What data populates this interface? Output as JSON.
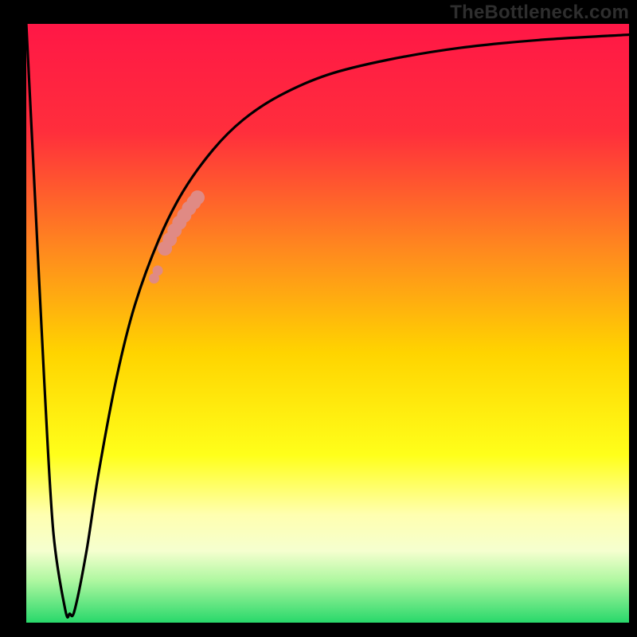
{
  "watermark": "TheBottleneck.com",
  "chart_data": {
    "type": "line",
    "title": "",
    "xlabel": "",
    "ylabel": "",
    "xlim": [
      0,
      100
    ],
    "ylim": [
      0,
      100
    ],
    "grid": false,
    "background_gradient": {
      "stops": [
        {
          "offset": 0.0,
          "color": "#ff1746"
        },
        {
          "offset": 0.18,
          "color": "#ff2e3c"
        },
        {
          "offset": 0.38,
          "color": "#ff8a1e"
        },
        {
          "offset": 0.55,
          "color": "#ffd400"
        },
        {
          "offset": 0.72,
          "color": "#ffff1a"
        },
        {
          "offset": 0.82,
          "color": "#ffffb0"
        },
        {
          "offset": 0.88,
          "color": "#f5ffcf"
        },
        {
          "offset": 0.93,
          "color": "#aef7a0"
        },
        {
          "offset": 1.0,
          "color": "#28d86a"
        }
      ]
    },
    "series": [
      {
        "name": "bottleneck-curve",
        "x": [
          0.0,
          1.5,
          3.0,
          4.5,
          6.5,
          7.2,
          8.0,
          10.0,
          12.0,
          15.0,
          18.0,
          22.0,
          26.0,
          31.0,
          36.0,
          42.0,
          50.0,
          60.0,
          72.0,
          85.0,
          100.0
        ],
        "y": [
          100.0,
          70.0,
          40.0,
          15.0,
          2.0,
          1.5,
          2.0,
          12.0,
          25.0,
          41.0,
          53.0,
          64.0,
          72.0,
          79.0,
          84.0,
          88.0,
          91.5,
          94.0,
          96.0,
          97.3,
          98.2
        ]
      }
    ],
    "highlight": {
      "name": "highlight-dots",
      "color": "#e08a84",
      "points_x": [
        21.2,
        21.8,
        23.0,
        23.8,
        24.6,
        25.4,
        26.2,
        27.0,
        27.8,
        28.4
      ],
      "points_y": [
        57.5,
        58.8,
        62.5,
        64.0,
        65.5,
        66.8,
        68.0,
        69.2,
        70.2,
        71.0
      ]
    }
  }
}
